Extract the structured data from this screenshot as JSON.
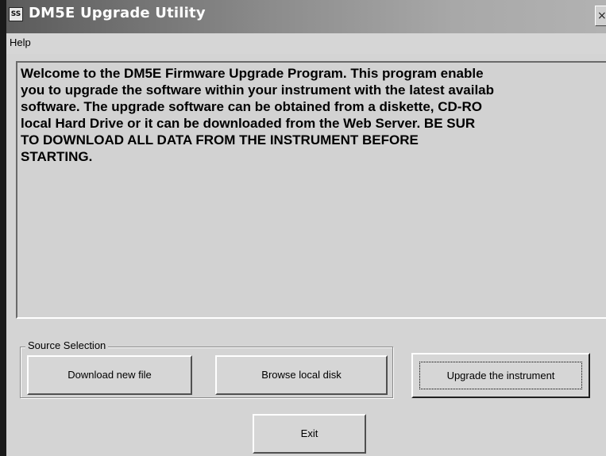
{
  "window": {
    "title": "DM5E Upgrade Utility",
    "app_icon_glyph": "SS",
    "close_glyph": "×"
  },
  "menu": {
    "items": [
      {
        "label": "Help"
      }
    ]
  },
  "welcome": {
    "lines": [
      "Welcome to the DM5E Firmware Upgrade Program. This program enable",
      "you to upgrade the software within your instrument with the latest availab",
      "software. The upgrade software can be obtained from a diskette, CD-RO",
      "local Hard Drive or it can be downloaded from the Web Server.  BE SUR",
      "TO DOWNLOAD ALL DATA FROM THE INSTRUMENT BEFORE",
      "STARTING."
    ]
  },
  "source_selection": {
    "label": "Source Selection",
    "download_label": "Download new file",
    "browse_label": "Browse local disk"
  },
  "actions": {
    "upgrade_label": "Upgrade the instrument",
    "exit_label": "Exit"
  },
  "icons": {
    "app": "app-logo-icon",
    "close": "close-icon"
  }
}
